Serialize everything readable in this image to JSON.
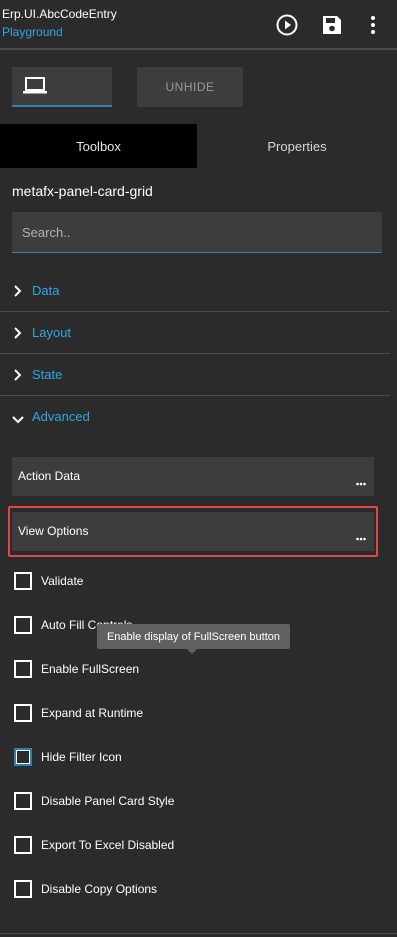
{
  "header": {
    "app_name": "Erp.UI.AbcCodeEntry",
    "subtitle": "Playground",
    "icons": [
      "play-circle-icon",
      "save-icon",
      "more-vertical-icon"
    ]
  },
  "toolbar": {
    "device_icon": "laptop-icon",
    "unhide_label": "UNHIDE"
  },
  "tabs": [
    {
      "label": "Toolbox",
      "active": true
    },
    {
      "label": "Properties",
      "active": false
    }
  ],
  "component_name": "metafx-panel-card-grid",
  "search": {
    "placeholder": "Search..",
    "value": ""
  },
  "sections": [
    {
      "label": "Data",
      "expanded": false
    },
    {
      "label": "Layout",
      "expanded": false
    },
    {
      "label": "State",
      "expanded": false
    },
    {
      "label": "Advanced",
      "expanded": true
    }
  ],
  "groups": [
    {
      "label": "Action Data"
    },
    {
      "label": "View Options"
    }
  ],
  "options": [
    {
      "label": "Validate",
      "checked": false
    },
    {
      "label": "Auto Fill Controls",
      "checked": false
    },
    {
      "label": "Enable FullScreen",
      "checked": false
    },
    {
      "label": "Expand at Runtime",
      "checked": false
    },
    {
      "label": "Hide Filter Icon",
      "checked": false
    },
    {
      "label": "Disable Panel Card Style",
      "checked": false
    },
    {
      "label": "Export To Excel Disabled",
      "checked": false
    },
    {
      "label": "Disable Copy Options",
      "checked": false
    }
  ],
  "tooltip": "Enable display of FullScreen button",
  "colors": {
    "accent": "#2fa8e0",
    "highlight": "#e04848",
    "background": "#2b2b2b"
  }
}
